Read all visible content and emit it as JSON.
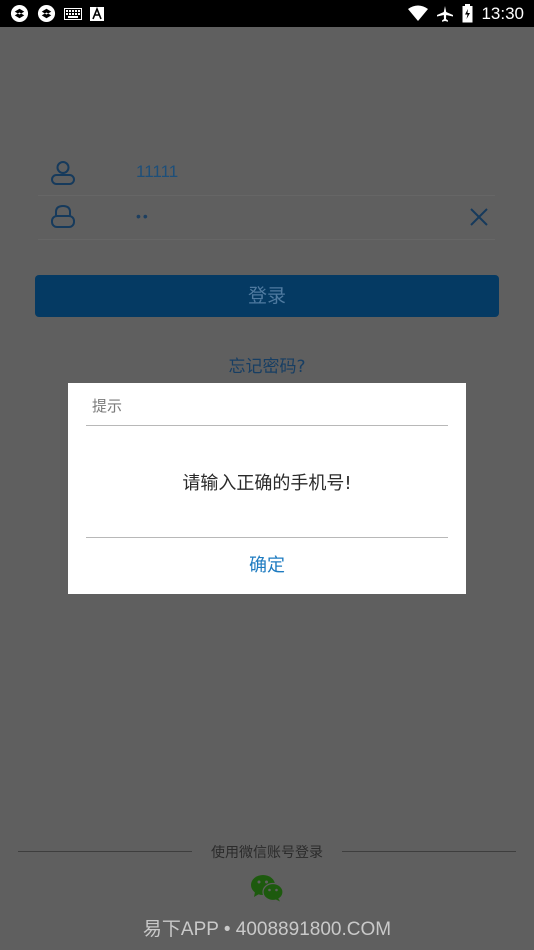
{
  "status_bar": {
    "time": "13:30",
    "icons": [
      "app-icon",
      "app-icon",
      "keyboard-icon",
      "a-icon",
      "wifi-icon",
      "airplane-icon",
      "battery-icon"
    ]
  },
  "login": {
    "phone_value": "11111",
    "password_value": "••",
    "login_label": "登录",
    "forgot_label": "忘记密码?"
  },
  "wechat": {
    "label": "使用微信账号登录"
  },
  "watermark": "易下APP • 4008891800.COM",
  "dialog": {
    "title": "提示",
    "message": "请输入正确的手机号!",
    "ok_label": "确定"
  },
  "colors": {
    "brand_blue": "#053a63",
    "link_blue": "#1e7bc0",
    "wechat_green": "#1d5a0e"
  }
}
